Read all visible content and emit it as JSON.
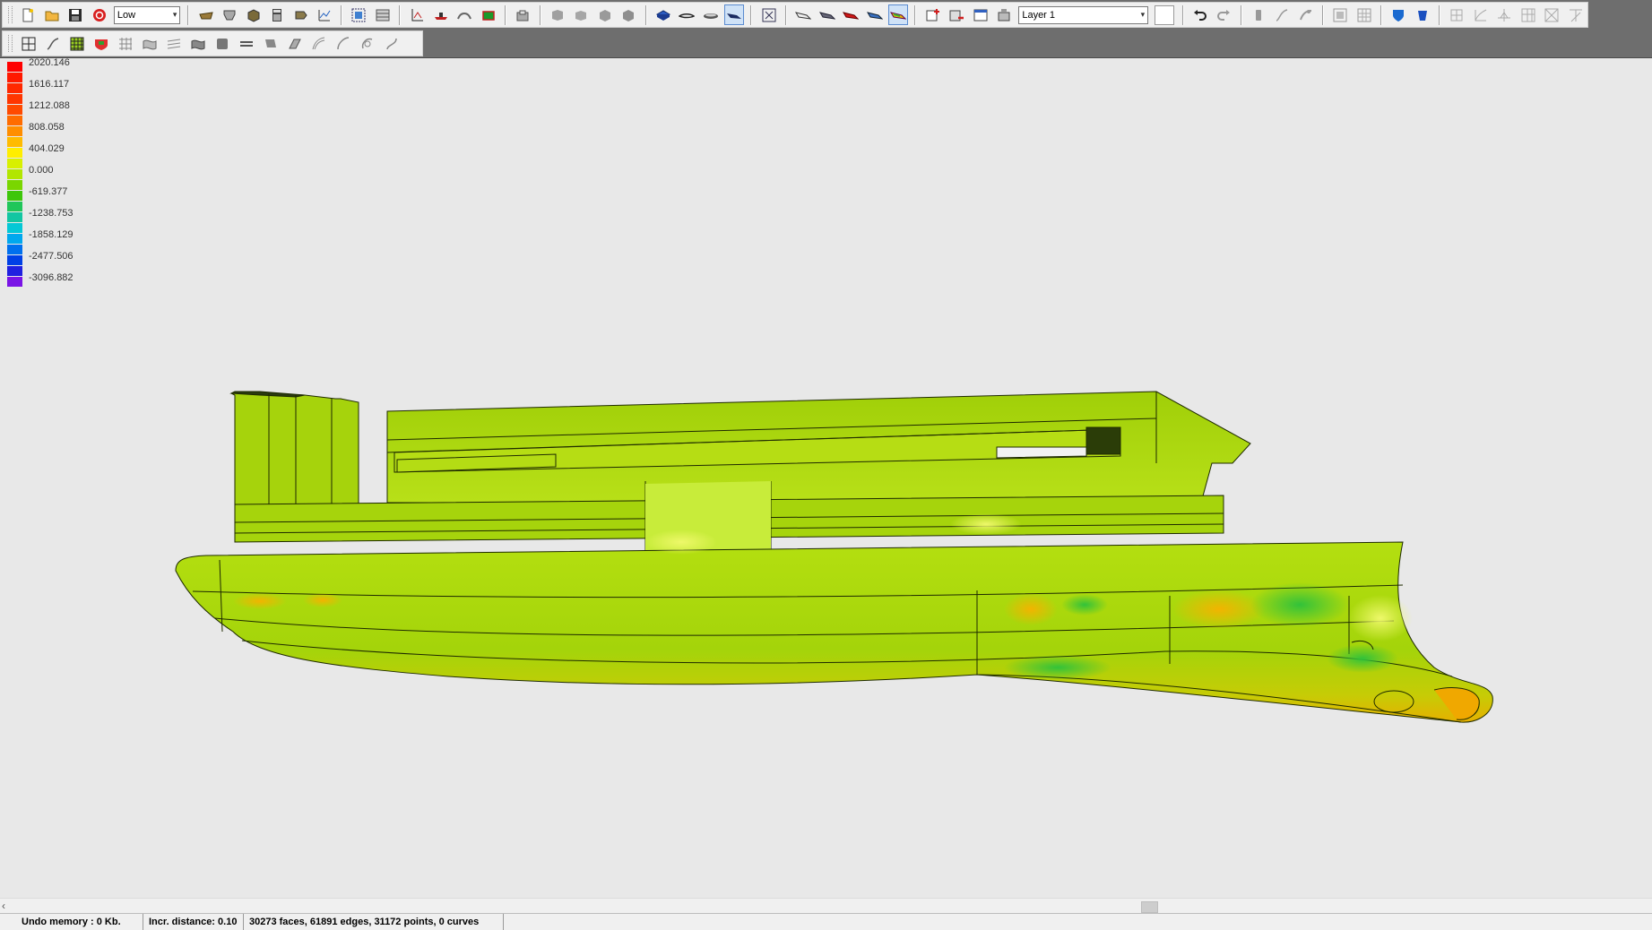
{
  "toolbar": {
    "quality_value": "Low",
    "layer_value": "Layer 1",
    "row1_groups": [
      [
        "new-file-icon",
        "open-folder-icon",
        "save-icon",
        "stop-icon"
      ],
      [
        "hull-icon",
        "transom-icon",
        "box-icon",
        "calculator-icon",
        "tools-icon",
        "chart-icon"
      ],
      [
        "frame-select-icon",
        "table-icon"
      ],
      [
        "axes-icon",
        "ship-profile-icon",
        "arch-icon",
        "color-block-icon"
      ],
      [
        "export-icon"
      ],
      [
        "view-front-icon",
        "view-side-icon",
        "view-top-icon",
        "view-persp-icon"
      ],
      [
        "shade-blue-icon",
        "wire-ship-icon",
        "flat-ship-icon",
        "ship-dark-icon"
      ],
      [
        "zoom-fit-icon"
      ],
      [
        "ship-white-icon",
        "ship-gray-icon",
        "ship-red-icon",
        "ship-blue-icon",
        "ship-curvature-icon"
      ],
      [
        "add-layer-icon",
        "delete-layer-icon",
        "layer-props-icon",
        "layer-tools-icon"
      ],
      [
        "undo-icon",
        "redo-icon"
      ],
      [
        "point-icon",
        "curve-icon",
        "edit-curve-icon"
      ],
      [
        "select-area-icon",
        "grid-select-icon"
      ],
      [
        "shield-icon",
        "bucket-icon"
      ],
      [
        "mesh-a-icon",
        "mesh-b-icon",
        "mesh-c-icon",
        "mesh-d-icon",
        "mesh-e-icon",
        "mesh-f-icon"
      ]
    ],
    "row2_icons": [
      "grid-icon",
      "curve-pen-icon",
      "mesh-grid-icon",
      "color-mesh-icon",
      "net-icon",
      "surface-icon",
      "lines-icon",
      "shaded-surface-icon",
      "shell-icon",
      "flow-icon",
      "shape-icon",
      "panel-icon",
      "curvature-icon",
      "spline-icon",
      "loop-icon",
      "twist-icon"
    ],
    "active_icons": [
      "ship-dark-icon",
      "ship-curvature-icon"
    ]
  },
  "legend": [
    {
      "color": "#ff0000",
      "label": "2020.146"
    },
    {
      "color": "#ff1900",
      "label": ""
    },
    {
      "color": "#ff2800",
      "label": "1616.117"
    },
    {
      "color": "#ff3600",
      "label": ""
    },
    {
      "color": "#ff4a00",
      "label": "1212.088"
    },
    {
      "color": "#ff6c00",
      "label": ""
    },
    {
      "color": "#ff8e00",
      "label": "808.058"
    },
    {
      "color": "#ffbb00",
      "label": ""
    },
    {
      "color": "#ffee00",
      "label": "404.029"
    },
    {
      "color": "#d8f000",
      "label": ""
    },
    {
      "color": "#b2e600",
      "label": "0.000"
    },
    {
      "color": "#7ad600",
      "label": ""
    },
    {
      "color": "#3ec60a",
      "label": "-619.377"
    },
    {
      "color": "#20c65a",
      "label": ""
    },
    {
      "color": "#12c6a2",
      "label": "-1238.753"
    },
    {
      "color": "#04c8d6",
      "label": ""
    },
    {
      "color": "#00a8ee",
      "label": "-1858.129"
    },
    {
      "color": "#0070ee",
      "label": ""
    },
    {
      "color": "#0040e6",
      "label": "-2477.506"
    },
    {
      "color": "#2020e0",
      "label": ""
    },
    {
      "color": "#7a14e6",
      "label": "-3096.882"
    }
  ],
  "status": {
    "undo": "Undo memory : 0 Kb.",
    "incr": "Incr. distance: 0.10",
    "counts": "30273 faces, 61891 edges, 31172 points, 0 curves"
  },
  "colors": {
    "hull_base": "#a2d40a",
    "hull_light": "#c4e81e",
    "hull_dark": "#86b006",
    "keel": "#e8b800"
  }
}
